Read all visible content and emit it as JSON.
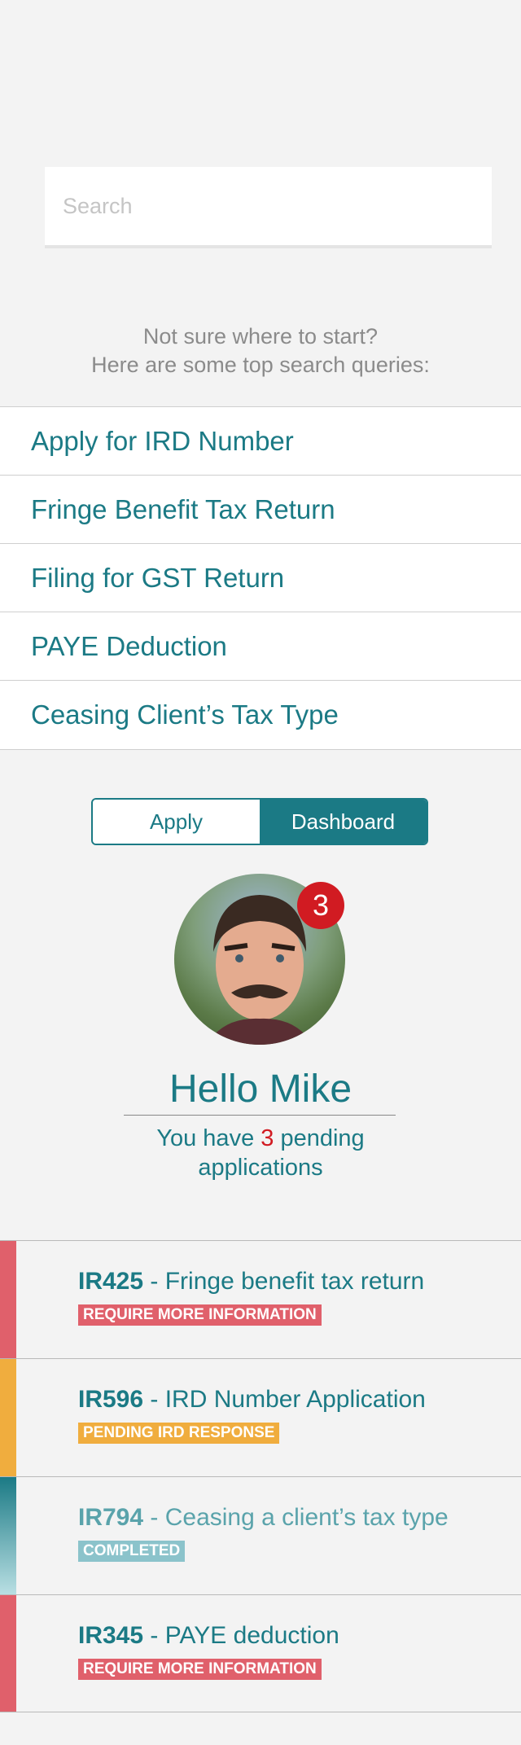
{
  "search": {
    "placeholder": "Search"
  },
  "hint": {
    "line1": "Not sure where to start?",
    "line2": "Here are some top search queries:"
  },
  "top_queries": [
    "Apply for IRD Number",
    "Fringe Benefit Tax Return",
    "Filing for GST Return",
    "PAYE Deduction",
    "Ceasing Client’s Tax Type"
  ],
  "toggle": {
    "apply": "Apply",
    "dashboard": "Dashboard"
  },
  "notifications": {
    "count": "3"
  },
  "greeting": "Hello Mike",
  "pending": {
    "prefix": "You have ",
    "count": "3",
    "suffix": " pending applications"
  },
  "applications": [
    {
      "code": "IR425",
      "title": " - Fringe benefit tax return",
      "status": "REQUIRE MORE INFORMATION",
      "color": "#e0606b"
    },
    {
      "code": "IR596",
      "title": " - IRD Number Application",
      "status": "PENDING IRD RESPONSE",
      "color": "#f0ad3e"
    },
    {
      "code": "IR794",
      "title": " - Ceasing a client’s tax type",
      "status": "COMPLETED",
      "color": "#8bc3cb"
    },
    {
      "code": "IR345",
      "title": " - PAYE deduction",
      "status": "REQUIRE MORE INFORMATION",
      "color": "#e0606b"
    }
  ]
}
